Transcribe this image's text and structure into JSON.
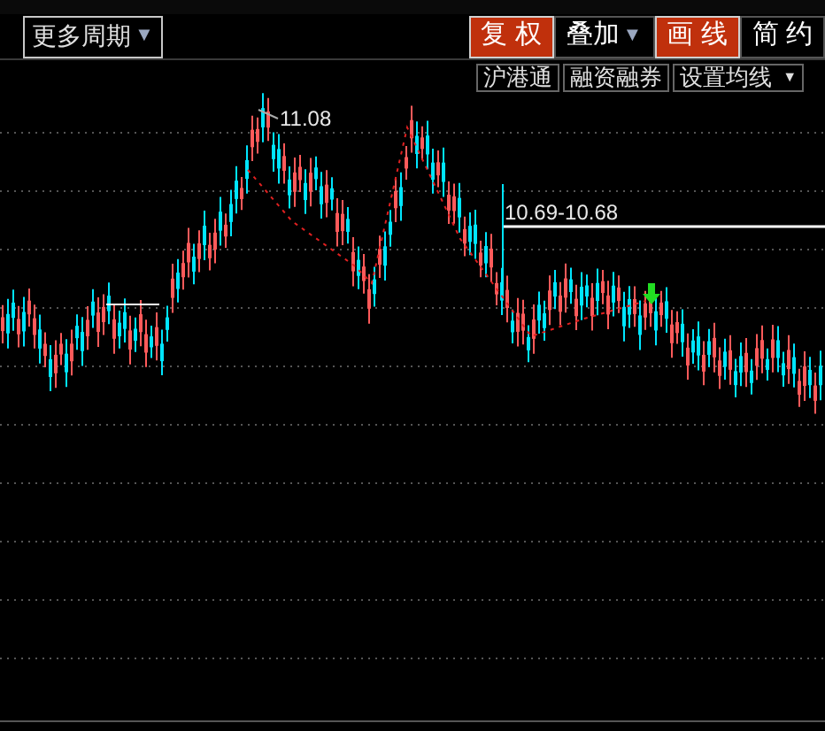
{
  "toolbar": {
    "period_button": {
      "label": "更多周期",
      "caret": "▼"
    },
    "right_buttons": [
      {
        "label": "复 权",
        "selected": true
      },
      {
        "label": "叠加",
        "selected": false,
        "caret": "▼"
      },
      {
        "label": "画 线",
        "selected": true
      },
      {
        "label": "简 约",
        "selected": false
      }
    ]
  },
  "sub_buttons": [
    {
      "label": "沪港通"
    },
    {
      "label": "融资融券"
    },
    {
      "label": "设置均线",
      "caret": "▼"
    }
  ],
  "chart": {
    "high_label": "11.08",
    "line_label": "10.69-10.68"
  }
}
